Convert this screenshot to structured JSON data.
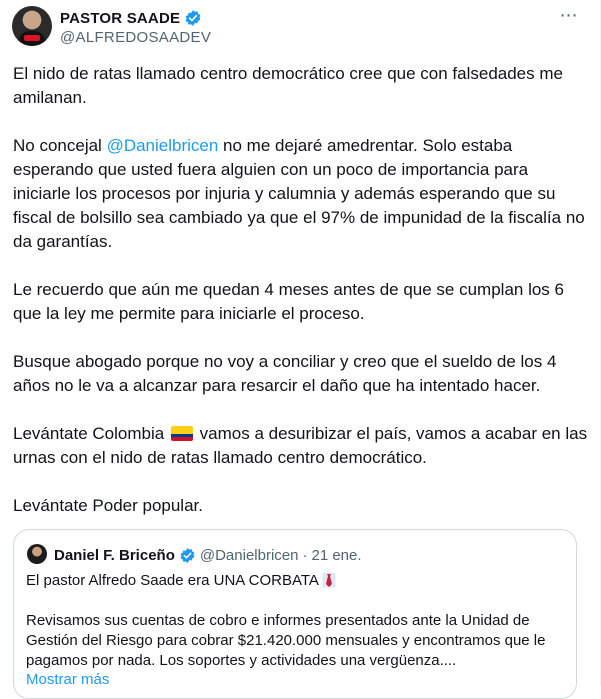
{
  "author": {
    "name": "PASTOR SAADE",
    "handle": "@ALFREDOSAADEV",
    "avatar_icon": "profile-photo"
  },
  "colors": {
    "link": "#1d9bf0",
    "verified": "#1d9bf0",
    "muted": "#536471",
    "border": "#cfd9de"
  },
  "more_icon": "⋯",
  "body": {
    "p1": "El nido de ratas llamado centro democrático cree que con falsedades me amilanan.",
    "p2_pre": "No concejal ",
    "p2_mention": "@Danielbricen",
    "p2_post": " no me dejaré amedrentar. Solo estaba esperando que usted fuera alguien con un poco de importancia para iniciarle los procesos por injuria y calumnia y además esperando que su fiscal de bolsillo sea cambiado ya que el 97% de impunidad de la fiscalía no da garantías.",
    "p3": "Le recuerdo que aún me quedan 4 meses antes de que se cumplan los 6 que la ley me permite para iniciarle el proceso.",
    "p4": "Busque abogado porque no voy a conciliar y creo que el sueldo de los 4 años no le va a alcanzar para resarcir el daño que ha intentado hacer.",
    "p5_pre": "Levántate Colombia ",
    "p5_post": " vamos a desuribizar el país, vamos a acabar en las urnas con el nido de ratas llamado centro democrático.",
    "p6": "Levántate Poder popular."
  },
  "quote": {
    "name": "Daniel F. Briceño",
    "handle": "@Danielbricen",
    "dot": "·",
    "date": "21 ene.",
    "title": "El pastor Alfredo Saade era UNA CORBATA",
    "text": "Revisamos sus cuentas de cobro e informes presentados ante la Unidad de Gestión del Riesgo para cobrar $21.420.000 mensuales y encontramos que le pagamos por nada. Los soportes y actividades una vergüenza....",
    "show_more": "Mostrar más"
  }
}
